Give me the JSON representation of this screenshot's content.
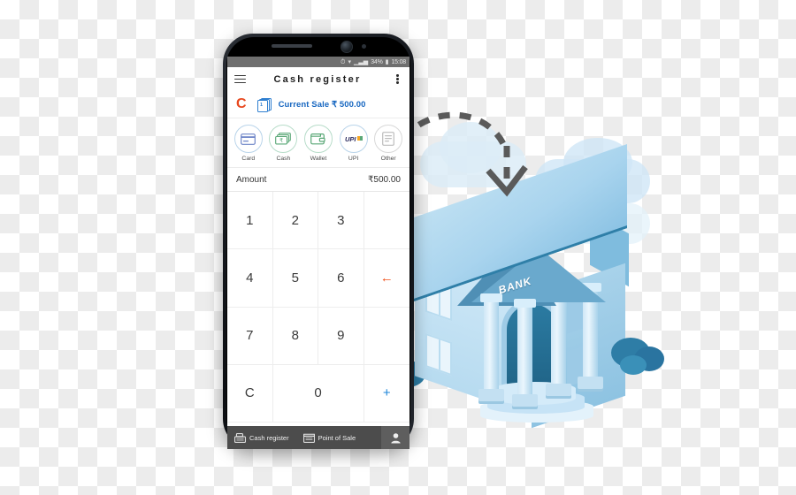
{
  "phone": {
    "status_bar": {
      "alarm_icon": "alarm-icon",
      "wifi_icon": "wifi-icon",
      "signal_icon": "signal-icon",
      "battery_percent": "34%",
      "battery_icon": "battery-icon",
      "time": "15:08"
    },
    "app_bar": {
      "menu_icon": "hamburger-menu-icon",
      "title": "Cash register",
      "overflow_icon": "overflow-menu-icon"
    },
    "current_sale": {
      "avatar_letter": "C",
      "stack_count": "1",
      "label": "Current Sale ₹ 500.00",
      "stack_icon": "stacked-receipts-icon"
    },
    "payment_methods": [
      {
        "label": "Card",
        "icon": "credit-card-icon"
      },
      {
        "label": "Cash",
        "icon": "banknotes-icon"
      },
      {
        "label": "Wallet",
        "icon": "wallet-icon"
      },
      {
        "label": "UPI",
        "icon": "upi-logo-icon"
      },
      {
        "label": "Other",
        "icon": "document-icon"
      }
    ],
    "amount": {
      "label": "Amount",
      "value": "₹500.00"
    },
    "keypad": {
      "keys": [
        "1",
        "2",
        "3",
        "4",
        "5",
        "6",
        "7",
        "8",
        "9",
        "C",
        "0"
      ],
      "backspace_icon": "backspace-arrow-icon",
      "plus_icon": "plus-icon"
    },
    "bottom_nav": [
      {
        "label": "Cash register",
        "icon": "cash-register-icon"
      },
      {
        "label": "Point of Sale",
        "icon": "point-of-sale-icon"
      }
    ],
    "profile_icon": "person-icon"
  },
  "illustration": {
    "bank_label": "BANK",
    "arrow_icon": "curved-dashed-arrow-icon",
    "building_icon": "bank-building-icon"
  },
  "colors": {
    "accent_orange": "#E8491F",
    "accent_blue": "#1666C0",
    "backspace_orange": "#F0541E",
    "plus_blue": "#1E86D8",
    "nav_bar": "#4C4C4C",
    "status_bar": "#6F6F6F",
    "bank_roof": "#2F7FA8"
  }
}
